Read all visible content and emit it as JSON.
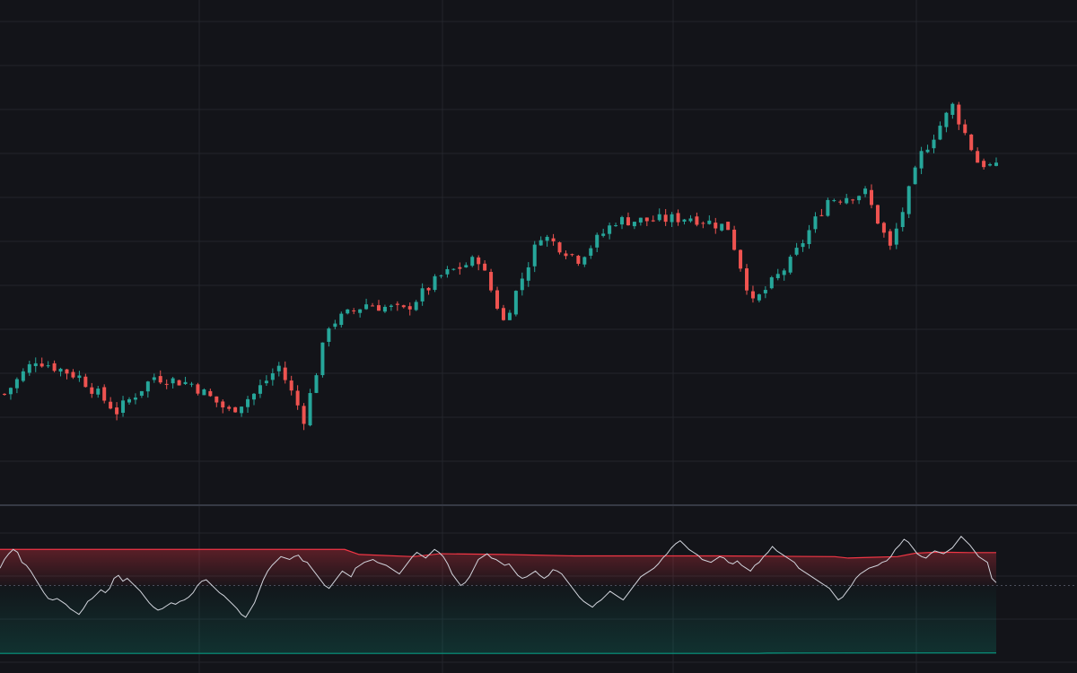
{
  "theme": {
    "background": "#131419",
    "grid": "#23252c",
    "separator": "#363a45",
    "up_color": "#26a69a",
    "down_color": "#ef5350",
    "indicator_line": "#d1d4dc",
    "upper_band": "#f23645",
    "lower_band": "#089981"
  },
  "chart_data": [
    {
      "type": "candlestick",
      "title": "",
      "xlabel": "",
      "ylabel": "",
      "grid": true,
      "axes_labels_visible": false,
      "ylim": [
        0,
        1
      ],
      "bar_count": 160,
      "close_path_keypoints": [
        [
          0,
          0.17
        ],
        [
          5,
          0.27
        ],
        [
          12,
          0.22
        ],
        [
          18,
          0.12
        ],
        [
          24,
          0.22
        ],
        [
          30,
          0.2
        ],
        [
          36,
          0.12
        ],
        [
          40,
          0.17
        ],
        [
          44,
          0.25
        ],
        [
          48,
          0.1
        ],
        [
          52,
          0.37
        ],
        [
          58,
          0.43
        ],
        [
          64,
          0.41
        ],
        [
          70,
          0.51
        ],
        [
          76,
          0.56
        ],
        [
          80,
          0.38
        ],
        [
          86,
          0.63
        ],
        [
          92,
          0.56
        ],
        [
          98,
          0.67
        ],
        [
          104,
          0.67
        ],
        [
          110,
          0.68
        ],
        [
          116,
          0.65
        ],
        [
          120,
          0.43
        ],
        [
          126,
          0.55
        ],
        [
          132,
          0.73
        ],
        [
          138,
          0.75
        ],
        [
          142,
          0.59
        ],
        [
          147,
          0.86
        ],
        [
          152,
          1.0
        ],
        [
          156,
          0.84
        ],
        [
          159,
          0.82
        ]
      ]
    },
    {
      "type": "line",
      "title": "",
      "grid": false,
      "ylim": [
        0,
        100
      ],
      "midline": 50,
      "series": [
        {
          "values": [
            62,
            68,
            72,
            75,
            73,
            66,
            64,
            60,
            55,
            50,
            45,
            41,
            40,
            41,
            39,
            37,
            34,
            32,
            30,
            34,
            39,
            41,
            44,
            47,
            45,
            48,
            55,
            57,
            53,
            55,
            52,
            49,
            46,
            42,
            38,
            35,
            33,
            34,
            36,
            38,
            37,
            39,
            40,
            42,
            45,
            50,
            53,
            54,
            51,
            48,
            45,
            43,
            40,
            37,
            34,
            30,
            28,
            33,
            38,
            46,
            54,
            60,
            64,
            67,
            70,
            69,
            68,
            70,
            71,
            67,
            66,
            62,
            58,
            54,
            50,
            48,
            52,
            56,
            60,
            58,
            56,
            62,
            64,
            66,
            67,
            68,
            66,
            65,
            64,
            62,
            60,
            58,
            62,
            66,
            70,
            73,
            71,
            69,
            72,
            75,
            73,
            70,
            65,
            58,
            54,
            50,
            52,
            56,
            62,
            68,
            70,
            72,
            69,
            68,
            66,
            64,
            65,
            61,
            57,
            55,
            56,
            58,
            60,
            57,
            55,
            57,
            61,
            60,
            58,
            54,
            50,
            46,
            42,
            39,
            37,
            35,
            38,
            40,
            43,
            46,
            44,
            42,
            40,
            44,
            48,
            52,
            56,
            58,
            60,
            62,
            65,
            69,
            72,
            76,
            79,
            81,
            78,
            75,
            73,
            71,
            68,
            67,
            66,
            68,
            70,
            69,
            66,
            65,
            67,
            64,
            62,
            60,
            64,
            66,
            70,
            73,
            77,
            74,
            72,
            70,
            68,
            66,
            62,
            60,
            58,
            56,
            54,
            52,
            50,
            48,
            44,
            40,
            42,
            46,
            50,
            55,
            58,
            60,
            62,
            63,
            64,
            66,
            67,
            70,
            75,
            78,
            82,
            80,
            76,
            72,
            70,
            69,
            72,
            74,
            73,
            72,
            74,
            76,
            80,
            84,
            81,
            78,
            74,
            70,
            68,
            66,
            55,
            52
          ]
        }
      ],
      "upper_band": [
        [
          0,
          75
        ],
        [
          384,
          75
        ],
        [
          400,
          71.5
        ],
        [
          460,
          70
        ],
        [
          480,
          71.3
        ],
        [
          490,
          72
        ],
        [
          560,
          71.5
        ],
        [
          640,
          70.5
        ],
        [
          720,
          70.5
        ],
        [
          800,
          70.5
        ],
        [
          930,
          70
        ],
        [
          945,
          69
        ],
        [
          970,
          69.5
        ],
        [
          1000,
          70
        ],
        [
          1020,
          72.4
        ],
        [
          1040,
          73
        ],
        [
          1060,
          73
        ],
        [
          1080,
          72.8
        ],
        [
          1110,
          72.8
        ]
      ],
      "lower_band": [
        [
          0,
          3
        ],
        [
          845,
          3
        ],
        [
          855,
          3.2
        ],
        [
          1000,
          3.3
        ],
        [
          1110,
          3.3
        ]
      ]
    }
  ]
}
